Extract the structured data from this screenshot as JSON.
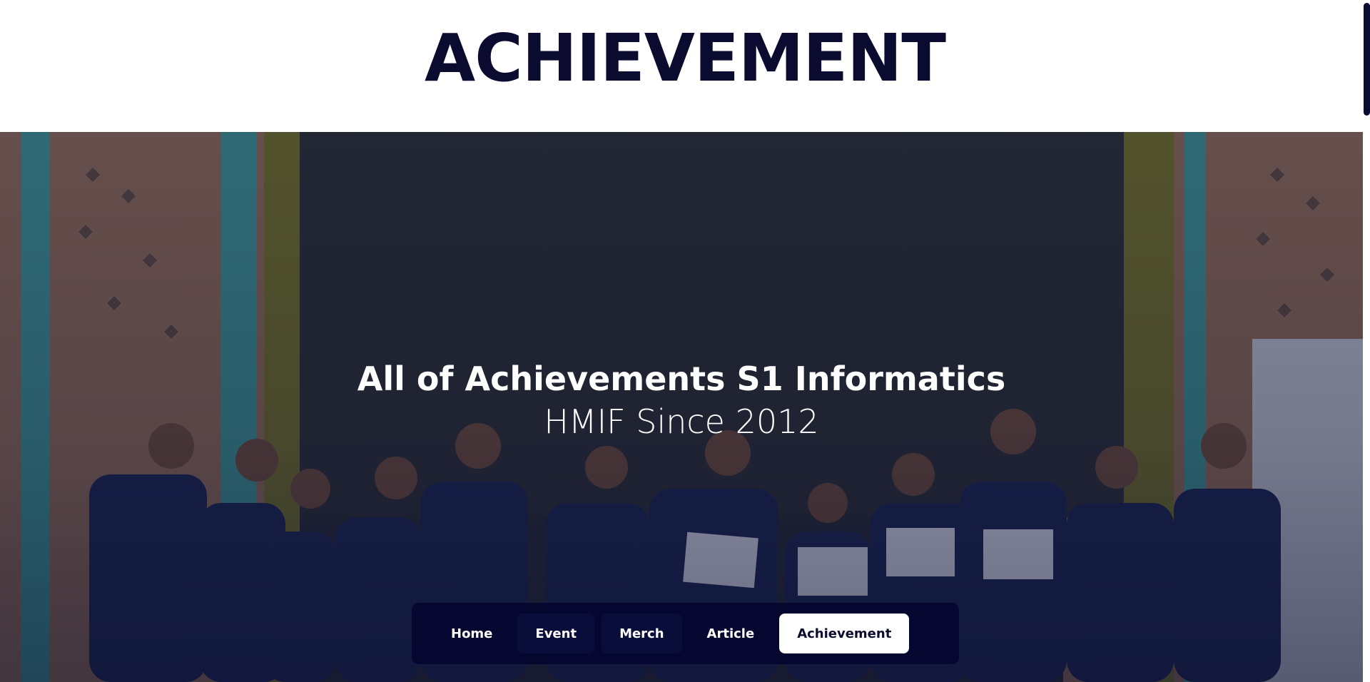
{
  "page": {
    "title": "ACHIEVEMENT"
  },
  "hero": {
    "title": "All of Achievements S1 Informatics",
    "subtitle": "HMIF Since 2012"
  },
  "nav": {
    "items": [
      {
        "label": "Home",
        "active": false
      },
      {
        "label": "Event",
        "active": false
      },
      {
        "label": "Merch",
        "active": false
      },
      {
        "label": "Article",
        "active": false
      },
      {
        "label": "Achievement",
        "active": true
      }
    ]
  },
  "colors": {
    "brand_navy": "#0a0b2e",
    "nav_background": "#040630",
    "active_tab_background": "#ffffff"
  }
}
